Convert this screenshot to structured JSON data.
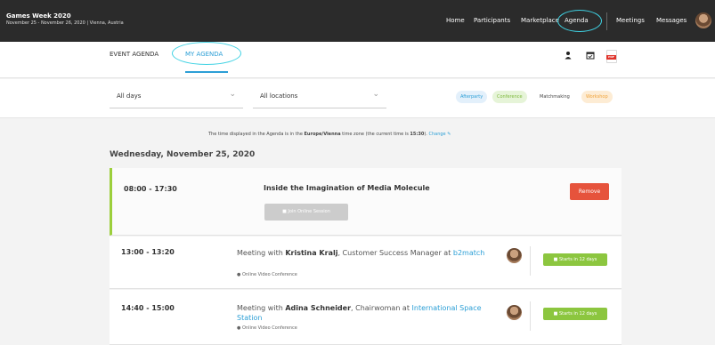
{
  "event": {
    "title": "Games Week 2020",
    "subtitle": "November 25 - November 26, 2020 | Vienna, Austria"
  },
  "nav": {
    "home": "Home",
    "participants": "Participants",
    "marketplace": "Marketplace",
    "agenda": "Agenda",
    "meetings": "Meetings",
    "messages": "Messages"
  },
  "tabs": {
    "event_agenda": "EVENT AGENDA",
    "my_agenda": "MY AGENDA"
  },
  "tools": {
    "person_icon": "person-icon",
    "calendar_icon": "calendar-check-icon",
    "pdf_label": "PDF"
  },
  "filters": {
    "days": "All days",
    "locations": "All locations",
    "tags": [
      {
        "label": "Afterparty",
        "bg": "#e3f0fb",
        "color": "#2c9fd6"
      },
      {
        "label": "Conference",
        "bg": "#e6f4d8",
        "color": "#7cb83a"
      },
      {
        "label": "Matchmaking",
        "bg": "#ffffff",
        "color": "#444444"
      },
      {
        "label": "Workshop",
        "bg": "#fdecd4",
        "color": "#f0a33a"
      }
    ]
  },
  "timezone": {
    "prefix": "The time displayed in the Agenda is in the",
    "zone": "Europe/Vienna",
    "middle": "time zone (the current time is",
    "time": "15:30",
    "suffix": ").",
    "change": "Change"
  },
  "day_heading": "Wednesday, November 25, 2020",
  "sessions": [
    {
      "time": "08:00 - 17:30",
      "title": "Inside the Imagination of Media Molecule",
      "join_label": "Join Online Session",
      "remove_label": "Remove"
    }
  ],
  "meetings": [
    {
      "time": "13:00 - 13:20",
      "prefix": "Meeting with",
      "person": "Kristina Kralj",
      "role": ", Customer Success Manager at",
      "org": "b2match",
      "location": "Online Video Conference",
      "start_label": "Starts in 12 days"
    },
    {
      "time": "14:40 - 15:00",
      "prefix": "Meeting with",
      "person": "Adina Schneider",
      "role": ", Chairwoman at",
      "org": "International Space Station",
      "location": "Online Video Conference",
      "start_label": "Starts in 12 days"
    }
  ],
  "colors": {
    "accent": "#2c9fd6",
    "highlight_circle": "#3fd2e3",
    "remove": "#e6533c",
    "start": "#8cc63f",
    "session_bar": "#9ccf3c"
  }
}
